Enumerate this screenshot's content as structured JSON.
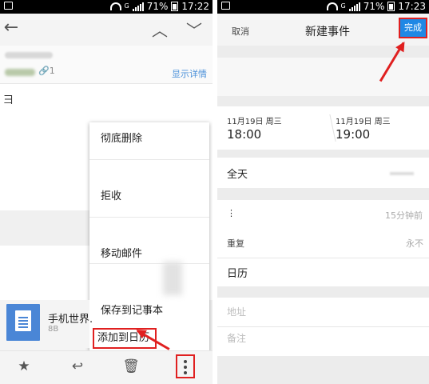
{
  "status_bar": {
    "signal": "G",
    "battery": "71%",
    "time_left": "17:22",
    "time_right": "17:23"
  },
  "left": {
    "show_details": "显示详情",
    "attachment_count": "1",
    "body_char": "彐",
    "menu": {
      "items": [
        "彻底删除",
        "拒收",
        "移动邮件",
        "保存到记事本",
        "添加到日历"
      ]
    },
    "attachment": {
      "name": "手机世界.",
      "size": "8B"
    }
  },
  "right": {
    "header": {
      "cancel": "取消",
      "title": "新建事件",
      "done": "完成"
    },
    "start": {
      "date": "11月19日 周三",
      "time": "18:00"
    },
    "end": {
      "date": "11月19日 周三",
      "time": "19:00"
    },
    "all_day": "全天",
    "reminder": {
      "label": "⋮",
      "value": "15分钟前"
    },
    "repeat": {
      "label": "重复",
      "value": "永不"
    },
    "calendar": "日历",
    "location_placeholder": "地址",
    "notes_placeholder": "备注"
  },
  "colors": {
    "accent": "#1f88e5",
    "annotation_red": "#e02020",
    "link_blue": "#4a90d9"
  }
}
